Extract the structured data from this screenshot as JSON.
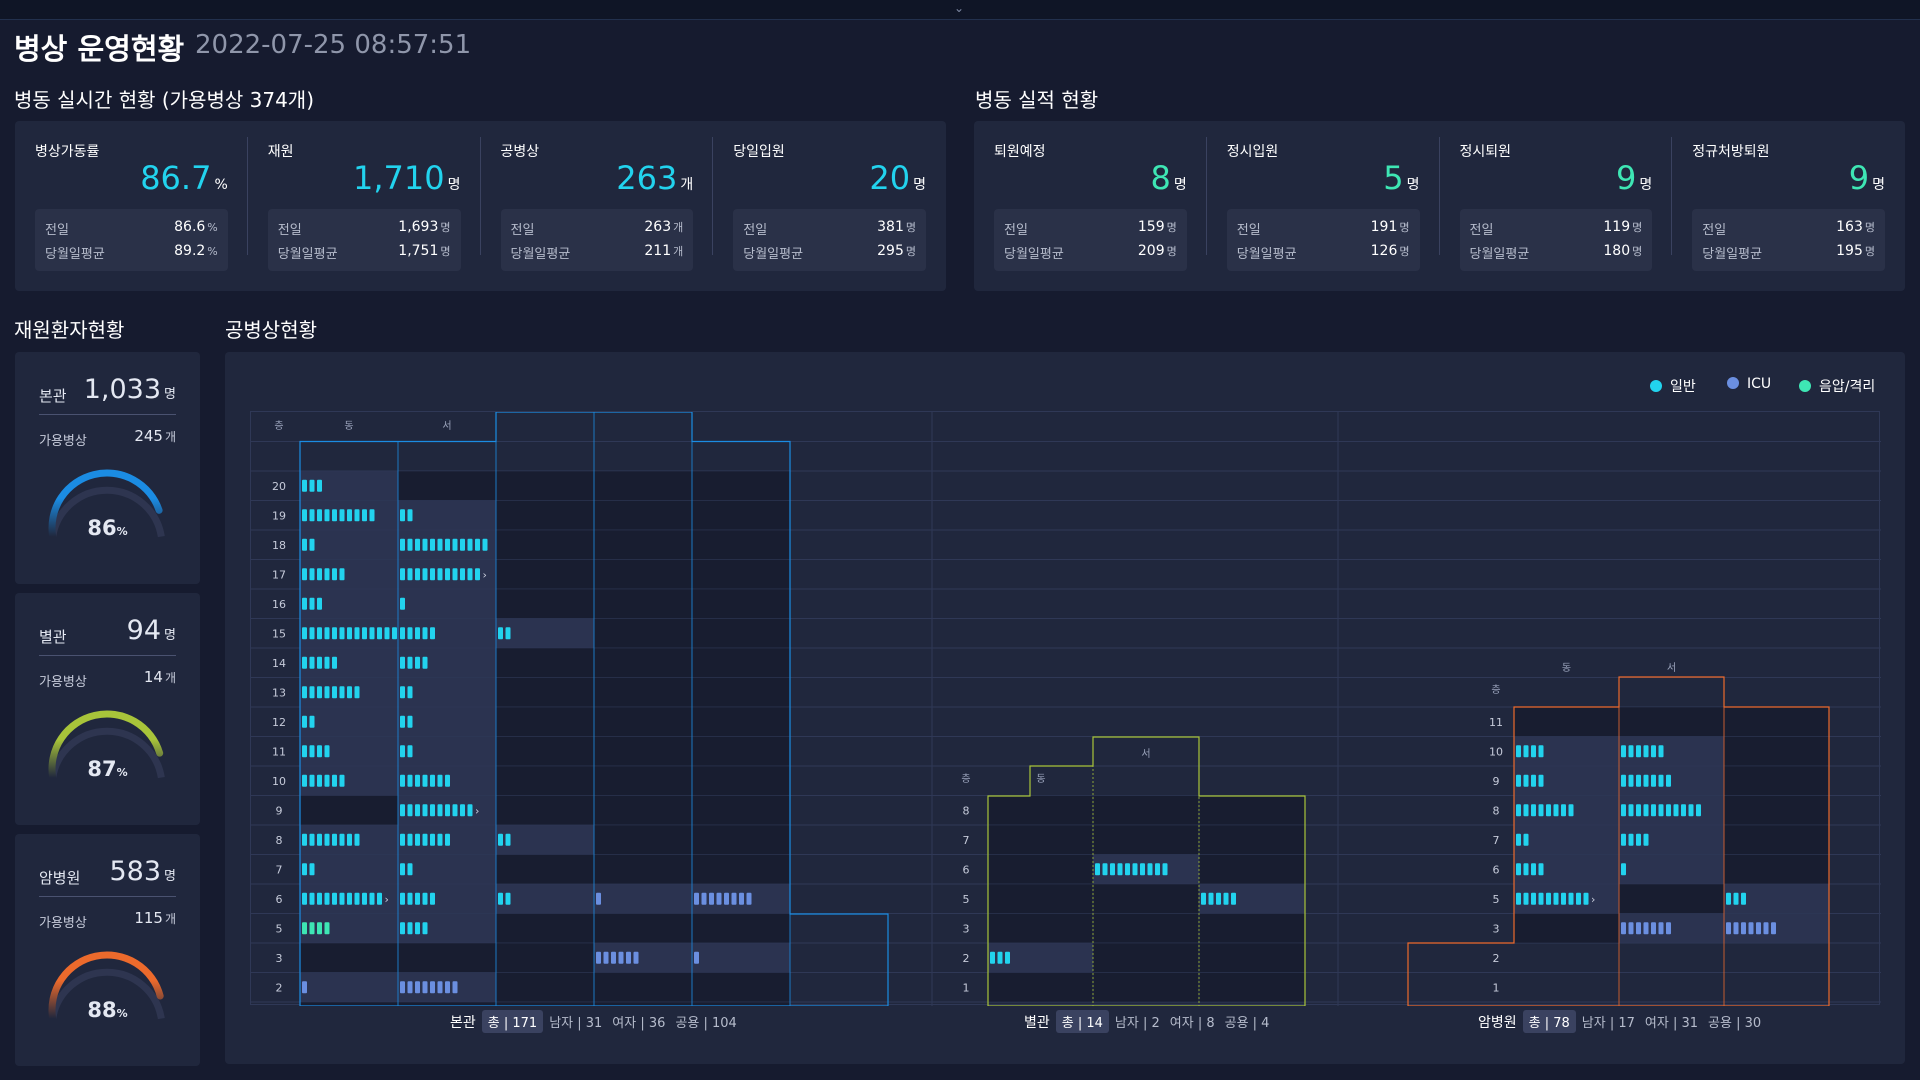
{
  "header": {
    "title": "병상 운영현황",
    "datetime": "2022-07-25 08:57:51"
  },
  "realtime": {
    "title": "병동 실시간 현황 (가용병상 374개)",
    "cards": [
      {
        "label": "병상가동률",
        "value": "86.7",
        "unit": "%",
        "prev": "86.6",
        "avg": "89.2",
        "sub_unit": "%"
      },
      {
        "label": "재원",
        "value": "1,710",
        "unit": "명",
        "prev": "1,693",
        "avg": "1,751",
        "sub_unit": "명"
      },
      {
        "label": "공병상",
        "value": "263",
        "unit": "개",
        "prev": "263",
        "avg": "211",
        "sub_unit": "개"
      },
      {
        "label": "당일입원",
        "value": "20",
        "unit": "명",
        "prev": "381",
        "avg": "295",
        "sub_unit": "명"
      }
    ]
  },
  "performance": {
    "title": "병동 실적 현황",
    "cards": [
      {
        "label": "퇴원예정",
        "value": "8",
        "unit": "명",
        "prev": "159",
        "avg": "209",
        "sub_unit": "명"
      },
      {
        "label": "정시입원",
        "value": "5",
        "unit": "명",
        "prev": "191",
        "avg": "126",
        "sub_unit": "명"
      },
      {
        "label": "정시퇴원",
        "value": "9",
        "unit": "명",
        "prev": "119",
        "avg": "180",
        "sub_unit": "명"
      },
      {
        "label": "정규처방퇴원",
        "value": "9",
        "unit": "명",
        "prev": "163",
        "avg": "195",
        "sub_unit": "명"
      }
    ]
  },
  "labels": {
    "prev": "전일",
    "avg": "당월일평균",
    "available": "가용병상"
  },
  "inpatient": {
    "title": "재원환자현황",
    "buildings": [
      {
        "name": "본관",
        "count": "1,033",
        "count_unit": "명",
        "available": "245",
        "available_unit": "개",
        "rate": 86,
        "rate_unit": "%",
        "color": "#1b8ce3"
      },
      {
        "name": "별관",
        "count": "94",
        "count_unit": "명",
        "available": "14",
        "available_unit": "개",
        "rate": 87,
        "rate_unit": "%",
        "color": "#a8c43a"
      },
      {
        "name": "암병원",
        "count": "583",
        "count_unit": "명",
        "available": "115",
        "available_unit": "개",
        "rate": 88,
        "rate_unit": "%",
        "color": "#ec6a2c"
      }
    ]
  },
  "empty_beds": {
    "title": "공병상현황",
    "legend": [
      {
        "name": "일반",
        "color": "#22d3ee"
      },
      {
        "name": "ICU",
        "color": "#6b8fe0"
      },
      {
        "name": "음압/격리",
        "color": "#3ee6b4"
      }
    ],
    "floor_header": "층",
    "east": "동",
    "west": "서",
    "buildings": [
      {
        "name": "본관",
        "total_label": "총",
        "total": "171",
        "stats": [
          {
            "label": "남자",
            "value": "31"
          },
          {
            "label": "여자",
            "value": "36"
          },
          {
            "label": "공용",
            "value": "104"
          }
        ],
        "color": "#1b8ce3",
        "floors": [
          {
            "floor": "20",
            "cells": [
              [
                3,
                "g"
              ],
              [
                0,
                ""
              ],
              [
                0,
                ""
              ],
              [
                0,
                ""
              ],
              [
                0,
                ""
              ]
            ]
          },
          {
            "floor": "19",
            "cells": [
              [
                10,
                "g"
              ],
              [
                2,
                "g"
              ],
              [
                0,
                ""
              ],
              [
                0,
                ""
              ],
              [
                0,
                ""
              ]
            ]
          },
          {
            "floor": "18",
            "cells": [
              [
                2,
                "g"
              ],
              [
                12,
                "g"
              ],
              [
                0,
                ""
              ],
              [
                0,
                ""
              ],
              [
                0,
                ""
              ]
            ]
          },
          {
            "floor": "17",
            "cells": [
              [
                6,
                "g"
              ],
              [
                11,
                "g",
                1
              ],
              [
                0,
                ""
              ],
              [
                0,
                ""
              ],
              [
                0,
                ""
              ]
            ]
          },
          {
            "floor": "16",
            "cells": [
              [
                3,
                "g"
              ],
              [
                1,
                "g"
              ],
              [
                0,
                ""
              ],
              [
                0,
                ""
              ],
              [
                0,
                ""
              ]
            ]
          },
          {
            "floor": "15",
            "cells": [
              [
                14,
                "g"
              ],
              [
                5,
                "g"
              ],
              [
                2,
                "g"
              ],
              [
                0,
                ""
              ],
              [
                0,
                ""
              ]
            ]
          },
          {
            "floor": "14",
            "cells": [
              [
                5,
                "g"
              ],
              [
                4,
                "g"
              ],
              [
                0,
                ""
              ],
              [
                0,
                ""
              ],
              [
                0,
                ""
              ]
            ]
          },
          {
            "floor": "13",
            "cells": [
              [
                8,
                "g"
              ],
              [
                2,
                "g"
              ],
              [
                0,
                ""
              ],
              [
                0,
                ""
              ],
              [
                0,
                ""
              ]
            ]
          },
          {
            "floor": "12",
            "cells": [
              [
                2,
                "g"
              ],
              [
                2,
                "g"
              ],
              [
                0,
                ""
              ],
              [
                0,
                ""
              ],
              [
                0,
                ""
              ]
            ]
          },
          {
            "floor": "11",
            "cells": [
              [
                4,
                "g"
              ],
              [
                2,
                "g"
              ],
              [
                0,
                ""
              ],
              [
                0,
                ""
              ],
              [
                0,
                ""
              ]
            ]
          },
          {
            "floor": "10",
            "cells": [
              [
                6,
                "g"
              ],
              [
                7,
                "g"
              ],
              [
                0,
                ""
              ],
              [
                0,
                ""
              ],
              [
                0,
                ""
              ]
            ]
          },
          {
            "floor": "9",
            "cells": [
              [
                0,
                ""
              ],
              [
                10,
                "g",
                1
              ],
              [
                0,
                ""
              ],
              [
                0,
                ""
              ],
              [
                0,
                ""
              ]
            ]
          },
          {
            "floor": "8",
            "cells": [
              [
                8,
                "g"
              ],
              [
                7,
                "g"
              ],
              [
                2,
                "g"
              ],
              [
                0,
                ""
              ],
              [
                0,
                ""
              ]
            ]
          },
          {
            "floor": "7",
            "cells": [
              [
                2,
                "g"
              ],
              [
                2,
                "g"
              ],
              [
                0,
                ""
              ],
              [
                0,
                ""
              ],
              [
                0,
                ""
              ]
            ]
          },
          {
            "floor": "6",
            "cells": [
              [
                11,
                "g",
                1
              ],
              [
                5,
                "g"
              ],
              [
                2,
                "g"
              ],
              [
                1,
                "i"
              ],
              [
                8,
                "i"
              ]
            ]
          },
          {
            "floor": "5",
            "cells": [
              [
                4,
                "n"
              ],
              [
                4,
                "g"
              ],
              [
                0,
                ""
              ],
              [
                0,
                ""
              ],
              [
                0,
                ""
              ]
            ]
          },
          {
            "floor": "3",
            "cells": [
              [
                0,
                ""
              ],
              [
                0,
                ""
              ],
              [
                0,
                ""
              ],
              [
                6,
                "i"
              ],
              [
                1,
                "i"
              ]
            ]
          },
          {
            "floor": "2",
            "cells": [
              [
                1,
                "i"
              ],
              [
                8,
                "i"
              ],
              [
                0,
                ""
              ],
              [
                0,
                ""
              ],
              [
                0,
                ""
              ]
            ]
          },
          {
            "floor": "1",
            "cells": [
              [
                0,
                ""
              ],
              [
                0,
                ""
              ],
              [
                0,
                ""
              ],
              [
                0,
                ""
              ],
              [
                0,
                ""
              ]
            ]
          }
        ]
      },
      {
        "name": "별관",
        "total_label": "총",
        "total": "14",
        "stats": [
          {
            "label": "남자",
            "value": "2"
          },
          {
            "label": "여자",
            "value": "8"
          },
          {
            "label": "공용",
            "value": "4"
          }
        ],
        "color": "#a8c43a",
        "floors": [
          {
            "floor": "8",
            "cells": [
              [
                0,
                ""
              ],
              [
                0,
                ""
              ],
              [
                0,
                ""
              ]
            ]
          },
          {
            "floor": "7",
            "cells": [
              [
                0,
                ""
              ],
              [
                0,
                ""
              ],
              [
                0,
                ""
              ]
            ]
          },
          {
            "floor": "6",
            "cells": [
              [
                0,
                ""
              ],
              [
                10,
                "g"
              ],
              [
                0,
                ""
              ]
            ]
          },
          {
            "floor": "5",
            "cells": [
              [
                0,
                ""
              ],
              [
                0,
                ""
              ],
              [
                5,
                "g"
              ]
            ]
          },
          {
            "floor": "3",
            "cells": [
              [
                0,
                ""
              ],
              [
                0,
                ""
              ],
              [
                0,
                ""
              ]
            ]
          },
          {
            "floor": "2",
            "cells": [
              [
                3,
                "g"
              ],
              [
                0,
                ""
              ],
              [
                0,
                ""
              ]
            ]
          },
          {
            "floor": "1",
            "cells": [
              [
                0,
                ""
              ],
              [
                0,
                ""
              ],
              [
                0,
                ""
              ]
            ]
          }
        ]
      },
      {
        "name": "암병원",
        "total_label": "총",
        "total": "78",
        "stats": [
          {
            "label": "남자",
            "value": "17"
          },
          {
            "label": "여자",
            "value": "31"
          },
          {
            "label": "공용",
            "value": "30"
          }
        ],
        "color": "#ec6a2c",
        "floors": [
          {
            "floor": "11",
            "cells": [
              [
                0,
                ""
              ],
              [
                0,
                ""
              ],
              [
                0,
                ""
              ]
            ]
          },
          {
            "floor": "10",
            "cells": [
              [
                4,
                "g"
              ],
              [
                6,
                "g"
              ],
              [
                0,
                ""
              ]
            ]
          },
          {
            "floor": "9",
            "cells": [
              [
                4,
                "g"
              ],
              [
                7,
                "g"
              ],
              [
                0,
                ""
              ]
            ]
          },
          {
            "floor": "8",
            "cells": [
              [
                8,
                "g"
              ],
              [
                11,
                "g"
              ],
              [
                0,
                ""
              ]
            ]
          },
          {
            "floor": "7",
            "cells": [
              [
                2,
                "g"
              ],
              [
                4,
                "g"
              ],
              [
                0,
                ""
              ]
            ]
          },
          {
            "floor": "6",
            "cells": [
              [
                4,
                "g"
              ],
              [
                1,
                "g"
              ],
              [
                0,
                ""
              ]
            ]
          },
          {
            "floor": "5",
            "cells": [
              [
                10,
                "g",
                1
              ],
              [
                0,
                ""
              ],
              [
                3,
                "g"
              ]
            ]
          },
          {
            "floor": "3",
            "cells": [
              [
                0,
                ""
              ],
              [
                7,
                "i"
              ],
              [
                7,
                "i"
              ]
            ]
          },
          {
            "floor": "2",
            "cells": [
              [
                0,
                ""
              ],
              [
                0,
                ""
              ],
              [
                0,
                ""
              ]
            ]
          },
          {
            "floor": "1",
            "cells": [
              [
                0,
                ""
              ],
              [
                0,
                ""
              ],
              [
                0,
                ""
              ]
            ]
          }
        ]
      }
    ]
  }
}
